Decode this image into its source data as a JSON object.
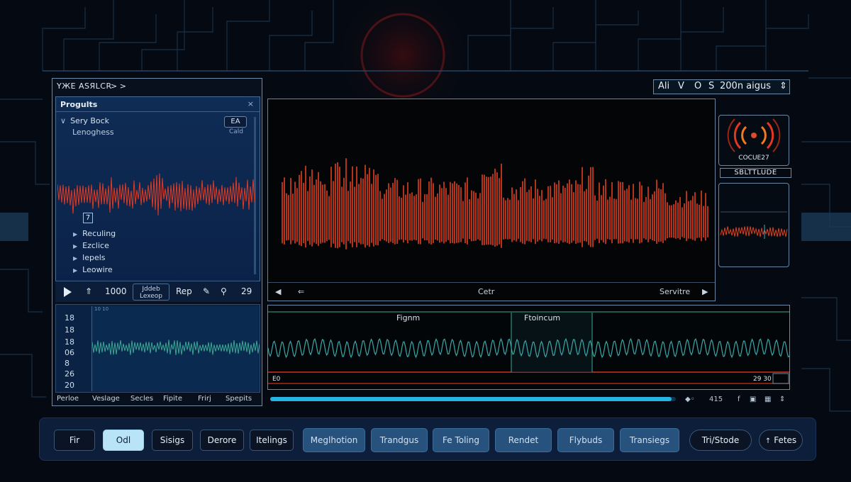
{
  "left_panel": {
    "title": "YЖE ASЯLCR",
    "title_arrow": "> >",
    "projects": {
      "header": "Progults",
      "close": "×",
      "root_item": "Sery Bock",
      "sub_item": "Lenoghess",
      "badge": "EA",
      "badge_sub": "Cald",
      "tag": "7",
      "items": [
        "Reculing",
        "Ezclice",
        "lepels",
        "Leowire"
      ]
    },
    "transport": {
      "time": "1000",
      "box_line1": "Jddeb",
      "box_line2": "Lexeop",
      "rep": "Rep",
      "count": "29"
    },
    "meter_labels": [
      "18",
      "18",
      "18",
      "06",
      "8",
      "26",
      "20"
    ],
    "meter_top": "10 10",
    "tabs": [
      "Perloe",
      "Veslage",
      "Secles",
      "Fipite",
      "Frirj",
      "Spepits"
    ]
  },
  "main_view": {
    "left_label": "Cetr",
    "right_label": "Servitre"
  },
  "top_control": {
    "ai": "Ali",
    "v": "V",
    "o": "O",
    "s": "S",
    "value": "200n aigus"
  },
  "right_column": {
    "meter_caption": "COCUE27",
    "status": "SBLTTLUDE"
  },
  "timeline": {
    "label_left": "Fignm",
    "label_right": "Ftoincum",
    "start": "E0",
    "end": "29 30"
  },
  "progress": {
    "value": 0.99,
    "info": "415",
    "icon_labels": [
      "f"
    ]
  },
  "toolbar": {
    "buttons": [
      "Fir",
      "Odl",
      "Sisigs",
      "Derore",
      "Itelings"
    ],
    "active": "Odl",
    "wide_buttons": [
      "Meglhotion",
      "Trandgus",
      "Fe Toling",
      "Rendet",
      "Flybuds",
      "Transiegs"
    ],
    "pill_left": "Tri/Stode",
    "pill_right": "Fetes"
  },
  "colors": {
    "accent_red": "#e33a1f",
    "accent_teal": "#3aa894",
    "accent_blue": "#26b4e2"
  }
}
